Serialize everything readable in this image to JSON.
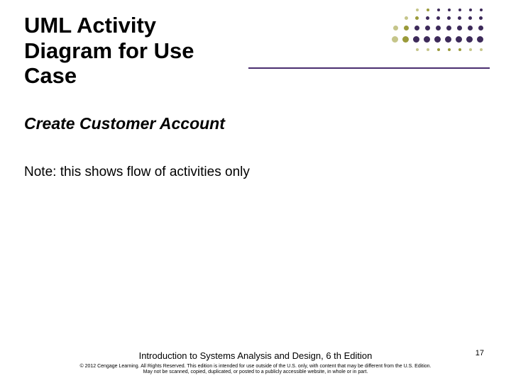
{
  "title": "UML Activity Diagram for Use Case",
  "subtitle": "Create Customer Account",
  "note": "Note: this shows flow of activities only",
  "footer": {
    "book": "Introduction to Systems Analysis and Design, 6 th Edition",
    "copyright_line1": "© 2012 Cengage Learning. All Rights Reserved. This edition is intended for use outside of the U.S. only, with content that may be different from the U.S. Edition.",
    "copyright_line2": "May not be scanned, copied, duplicated, or posted to a publicly accessible website, in whole or in part."
  },
  "page_number": "17",
  "decoration": {
    "colors": {
      "dark_purple": "#3d2a5a",
      "olive": "#9a9a3a",
      "light_olive": "#c5c58a"
    }
  }
}
